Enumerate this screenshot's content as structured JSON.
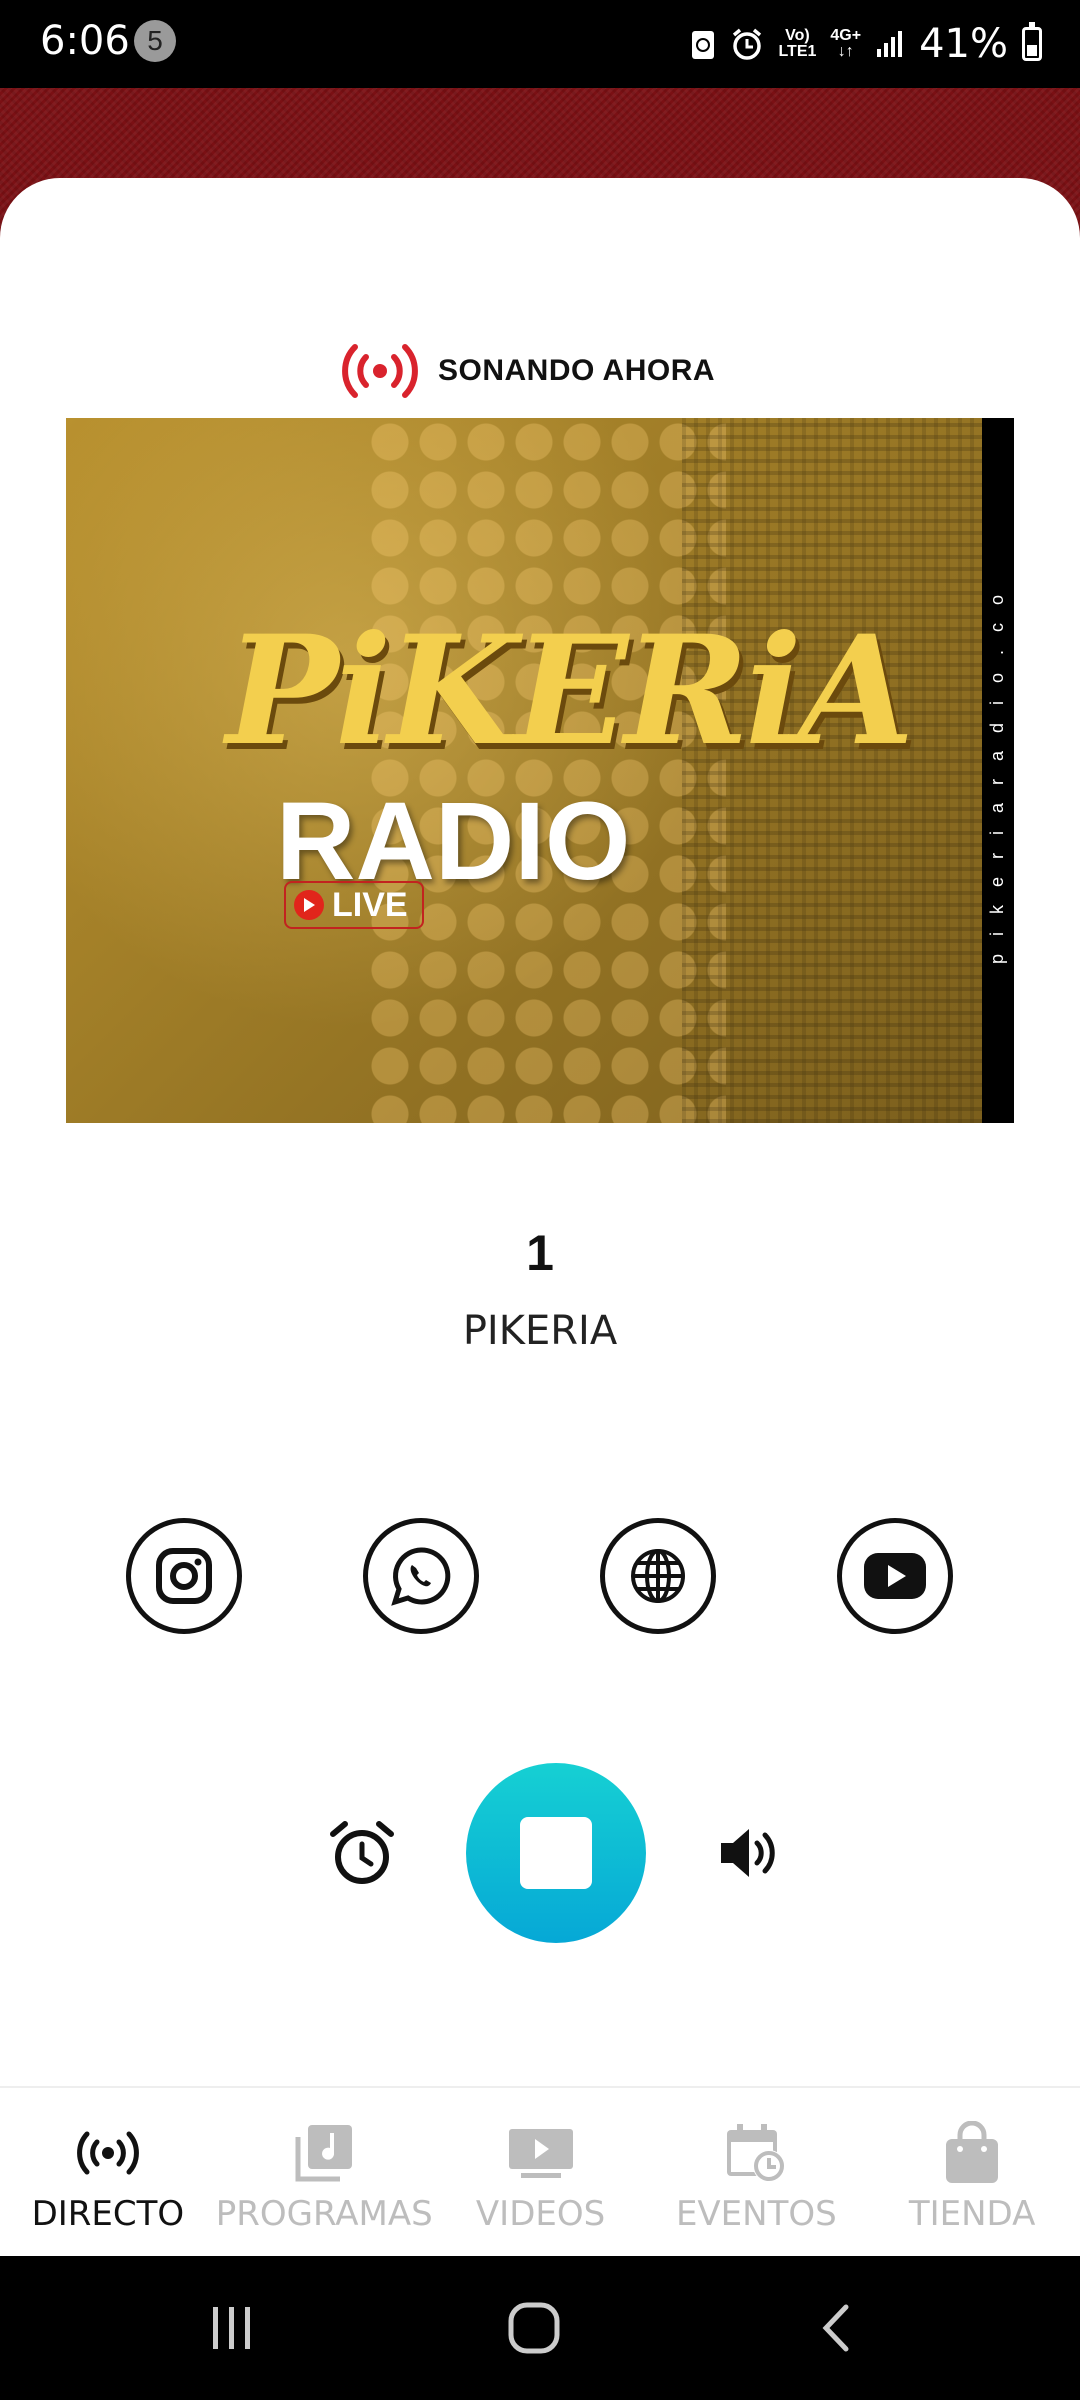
{
  "status_bar": {
    "time": "6:06",
    "notification_count": "5",
    "network_top": "Vo)",
    "network_bottom": "LTE1",
    "data_type": "4G+",
    "battery": "41%"
  },
  "now_playing": {
    "label": "SONANDO AHORA"
  },
  "cover": {
    "title": "PiKERiA",
    "subtitle": "RADIO",
    "live": "LIVE",
    "side_text": "pikeriaradio.co"
  },
  "track": {
    "number": "1",
    "artist": "PIKERIA"
  },
  "social": [
    "instagram-icon",
    "whatsapp-icon",
    "globe-icon",
    "youtube-icon"
  ],
  "colors": {
    "accent": "#0ab8d5",
    "header": "#7b1014",
    "live_red": "#e1251b"
  },
  "nav": {
    "items": [
      {
        "label": "DIRECTO",
        "icon": "broadcast-icon",
        "active": true
      },
      {
        "label": "PROGRAMAS",
        "icon": "music-library-icon",
        "active": false
      },
      {
        "label": "VIDEOS",
        "icon": "video-icon",
        "active": false
      },
      {
        "label": "EVENTOS",
        "icon": "calendar-clock-icon",
        "active": false
      },
      {
        "label": "TIENDA",
        "icon": "shopping-bag-icon",
        "active": false
      }
    ]
  }
}
